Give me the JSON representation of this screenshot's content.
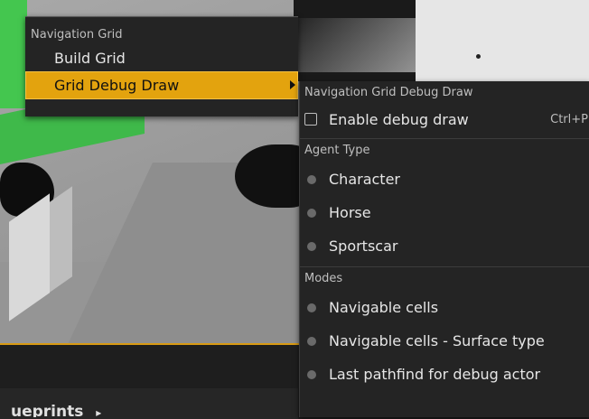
{
  "main_menu": {
    "section_title": "Navigation Grid",
    "items": [
      {
        "label": "Build Grid"
      },
      {
        "label": "Grid Debug Draw"
      }
    ]
  },
  "submenu": {
    "section_title": "Navigation Grid Debug Draw",
    "enable_debug_draw": {
      "label": "Enable debug draw",
      "shortcut": "Ctrl+P",
      "checked": false
    },
    "agent_type": {
      "title": "Agent Type",
      "options": [
        {
          "label": "Character"
        },
        {
          "label": "Horse"
        },
        {
          "label": "Sportscar"
        }
      ]
    },
    "modes": {
      "title": "Modes",
      "options": [
        {
          "label": "Navigable cells"
        },
        {
          "label": "Navigable cells - Surface type"
        },
        {
          "label": "Last pathfind for debug actor"
        }
      ]
    }
  },
  "bottom": {
    "blueprints_label": "ueprints"
  },
  "colors": {
    "accent": "#e3a30e",
    "menu_bg": "#242424",
    "green_block": "#3fb94a"
  },
  "icons": {
    "submenu_arrow": "chevron-right-icon",
    "radio": "radio-dot-icon",
    "checkbox": "checkbox-icon"
  }
}
